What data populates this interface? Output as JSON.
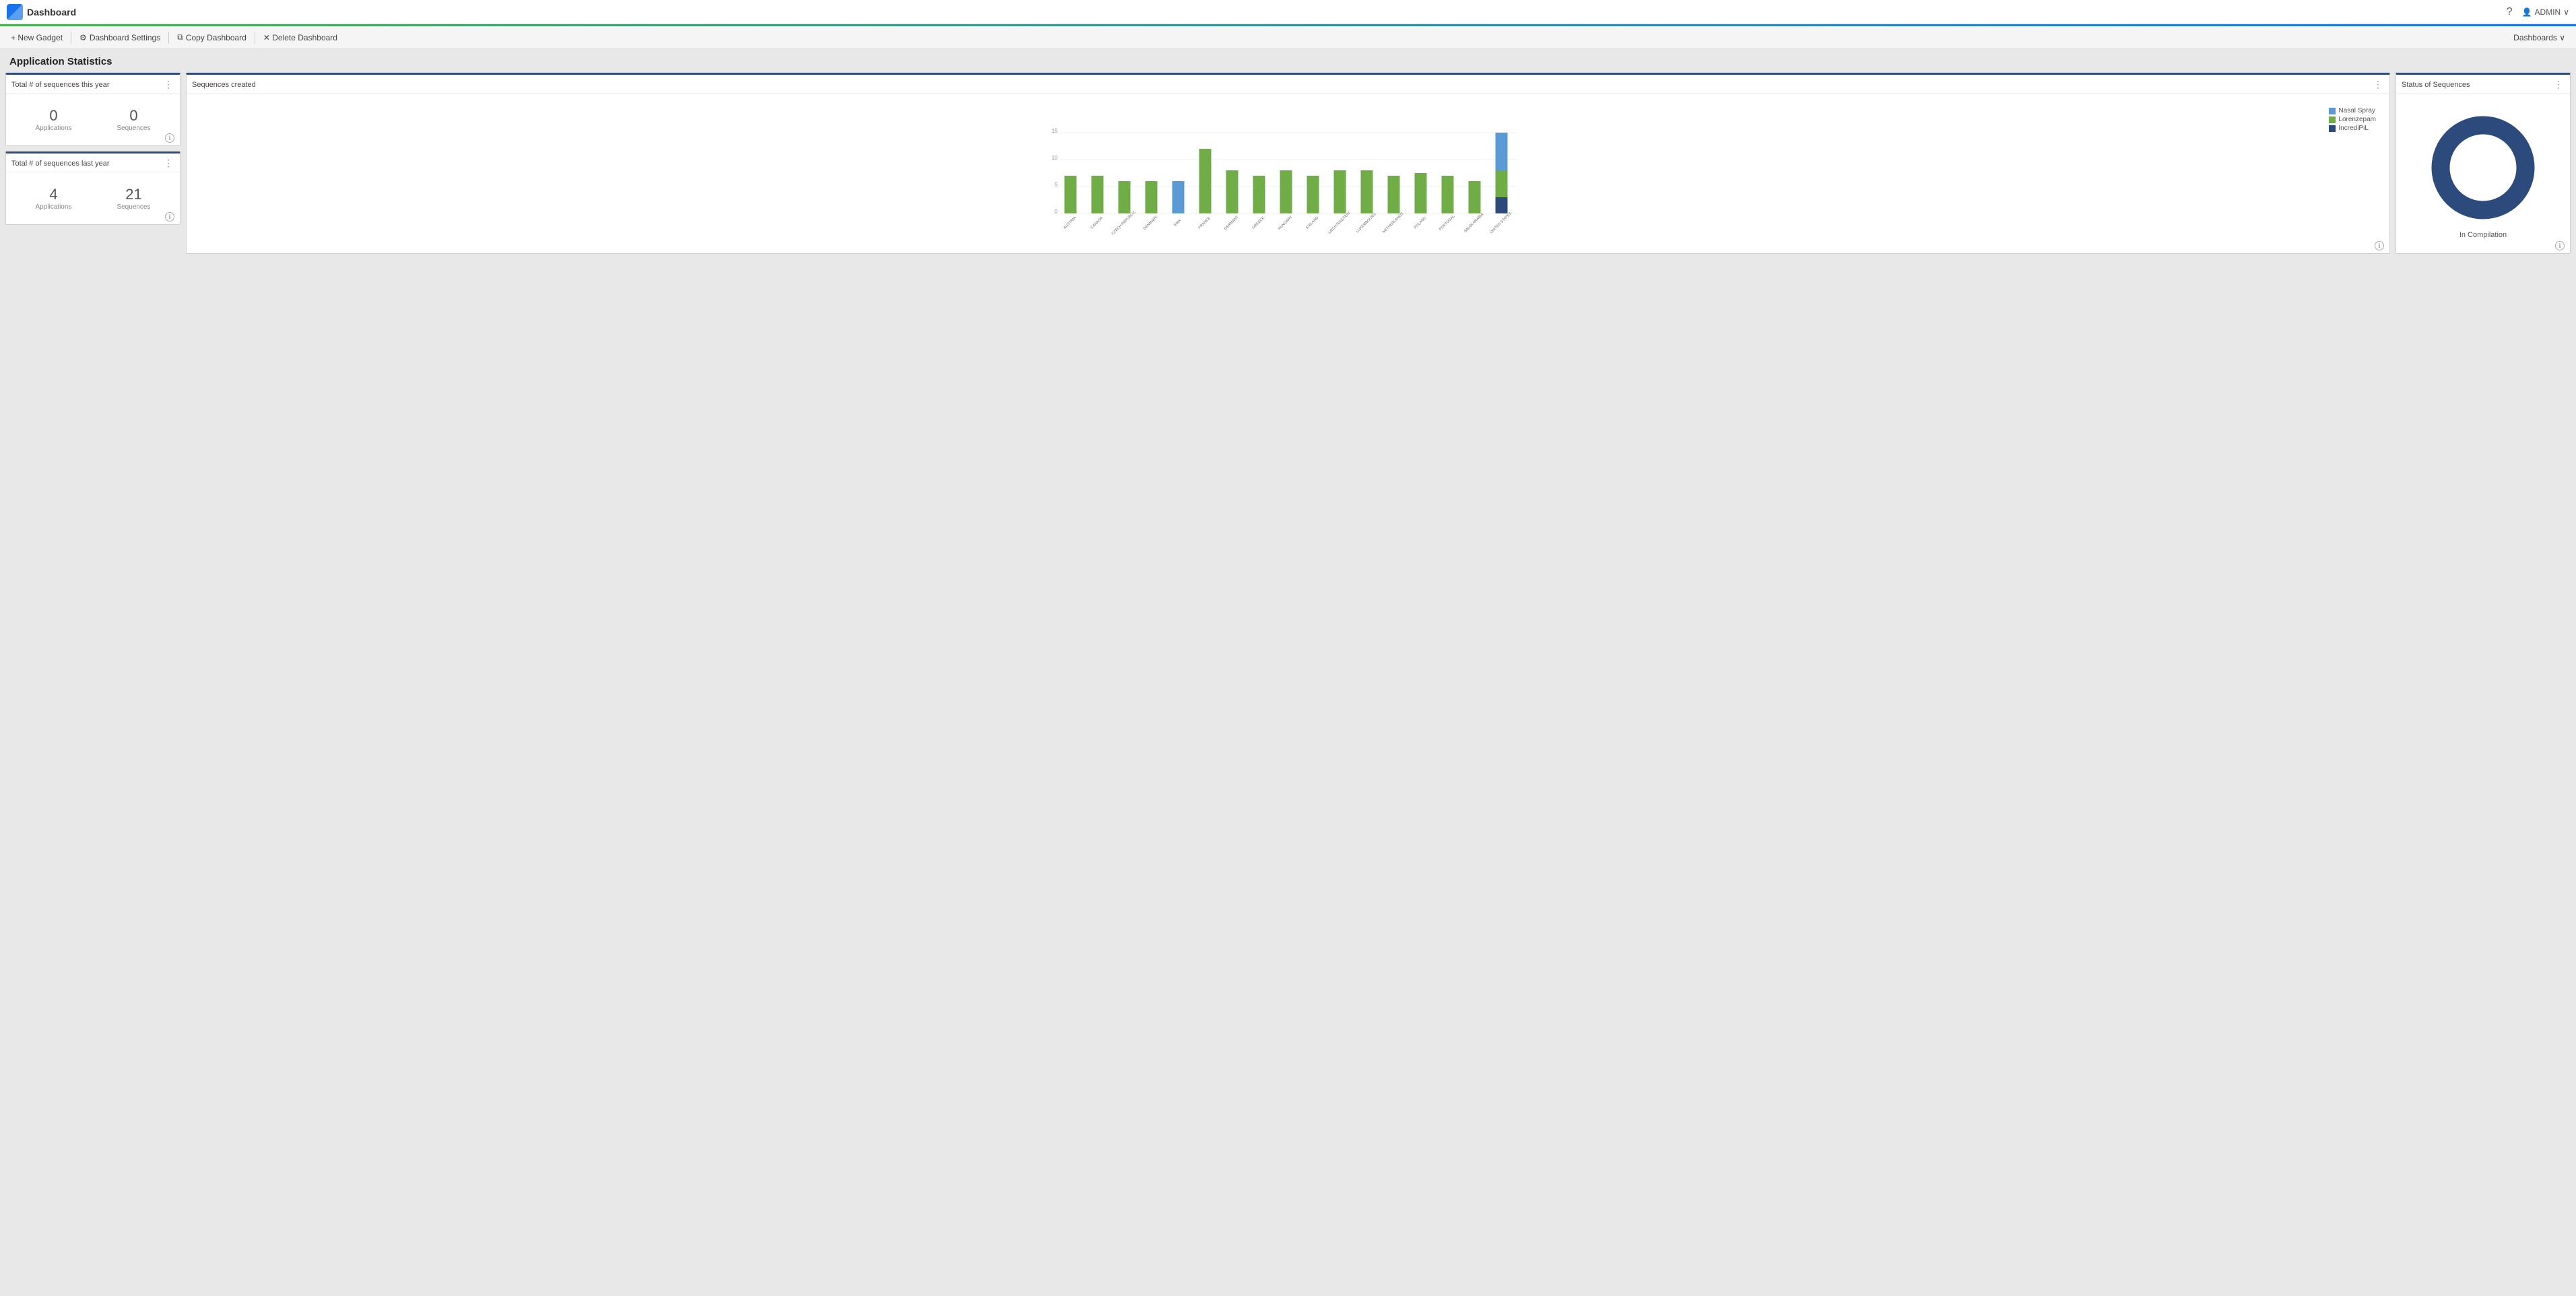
{
  "app": {
    "logo_text": "Dashboard",
    "help_icon": "?",
    "user_icon": "👤",
    "user_label": "ADMIN",
    "user_caret": "∨"
  },
  "toolbar": {
    "new_gadget": "+ New Gadget",
    "dashboard_settings": "Dashboard Settings",
    "copy_dashboard": "Copy Dashboard",
    "delete_dashboard": "✕ Delete Dashboard",
    "dashboards": "Dashboards ∨"
  },
  "page": {
    "title": "Application Statistics"
  },
  "widget_this_year": {
    "title": "Total # of sequences this year",
    "applications_value": "0",
    "applications_label": "Applications",
    "sequences_value": "0",
    "sequences_label": "Sequences"
  },
  "widget_last_year": {
    "title": "Total # of sequences last year",
    "applications_value": "4",
    "applications_label": "Applications",
    "sequences_value": "21",
    "sequences_label": "Sequences"
  },
  "widget_sequences_created": {
    "title": "Sequences created",
    "legend": [
      {
        "label": "Nasal Spray",
        "color": "#5b9bd5"
      },
      {
        "label": "Lorenzepam",
        "color": "#70ad47"
      },
      {
        "label": "IncrediPiL",
        "color": "#2c4a7c"
      }
    ],
    "countries": [
      "AUSTRIA",
      "CANADA",
      "CZECH REPUBLIC",
      "DENMARK",
      "EMA",
      "FRANCE",
      "GERMANY",
      "GREECE",
      "HUNGARY",
      "ICELAND",
      "LIECHTENSTEIN",
      "LUXEMBOURG",
      "NETHERLANDS",
      "POLAND",
      "PORTUGAL",
      "SAUDI ARABIA",
      "UNITED STATES"
    ],
    "bars": [
      {
        "nasal": 0,
        "lorenz": 7,
        "incredi": 0
      },
      {
        "nasal": 0,
        "lorenz": 7,
        "incredi": 0
      },
      {
        "nasal": 0,
        "lorenz": 6,
        "incredi": 0
      },
      {
        "nasal": 0,
        "lorenz": 6,
        "incredi": 0
      },
      {
        "nasal": 6,
        "lorenz": 0,
        "incredi": 0
      },
      {
        "nasal": 0,
        "lorenz": 12,
        "incredi": 0
      },
      {
        "nasal": 0,
        "lorenz": 8,
        "incredi": 0
      },
      {
        "nasal": 0,
        "lorenz": 7,
        "incredi": 0
      },
      {
        "nasal": 0,
        "lorenz": 8,
        "incredi": 0
      },
      {
        "nasal": 0,
        "lorenz": 7,
        "incredi": 0
      },
      {
        "nasal": 0,
        "lorenz": 8,
        "incredi": 0
      },
      {
        "nasal": 0,
        "lorenz": 8,
        "incredi": 0
      },
      {
        "nasal": 0,
        "lorenz": 7,
        "incredi": 0
      },
      {
        "nasal": 0,
        "lorenz": 7.5,
        "incredi": 0
      },
      {
        "nasal": 0,
        "lorenz": 7,
        "incredi": 0
      },
      {
        "nasal": 0,
        "lorenz": 6,
        "incredi": 0
      },
      {
        "nasal": 7,
        "lorenz": 5,
        "incredi": 3
      }
    ],
    "y_labels": [
      "0",
      "5",
      "10",
      "15"
    ],
    "colors": {
      "nasal": "#5b9bd5",
      "lorenz": "#70ad47",
      "incredi": "#2c4a7c"
    }
  },
  "widget_status": {
    "title": "Status of Sequences",
    "donut_label": "In Compilation",
    "donut_color": "#2c4a7c",
    "donut_inner": "#fff"
  }
}
